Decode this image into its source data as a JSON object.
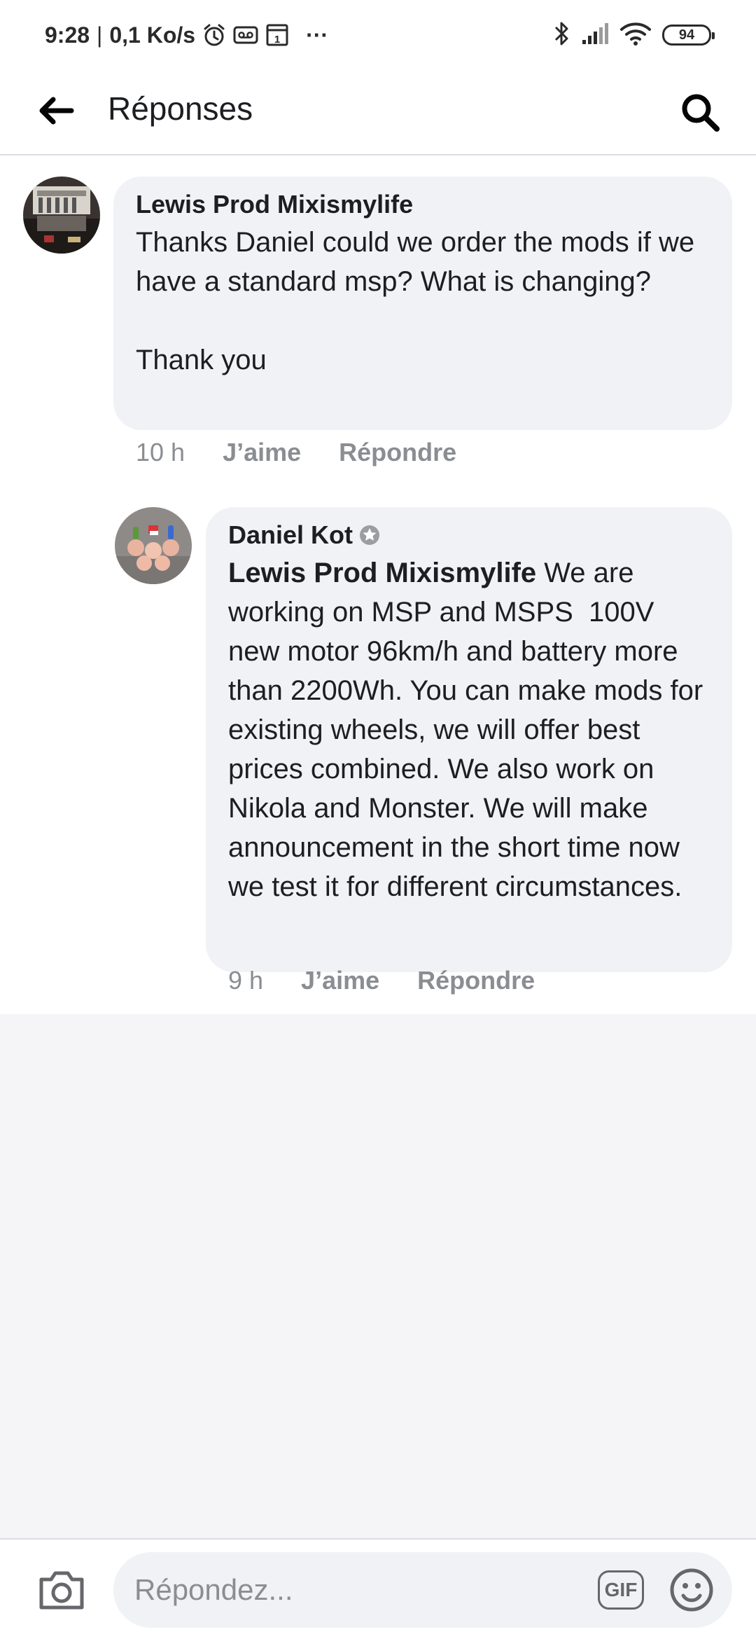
{
  "status_bar": {
    "time": "9:28",
    "separator": "|",
    "network_speed": "0,1 Ko/s",
    "more": "···",
    "battery": "94",
    "icons": [
      "alarm-icon",
      "voicemail-icon",
      "calendar-icon",
      "bluetooth-icon",
      "signal-icon",
      "wifi-icon",
      "battery-icon"
    ]
  },
  "header": {
    "title": "Réponses",
    "back_icon": "arrow-left-icon",
    "search_icon": "search-icon"
  },
  "comments": [
    {
      "author": "Lewis Prod Mixismylife",
      "text": "Thanks Daniel could we order the mods if we have a standard msp? What is changing?\n\nThank you",
      "time": "10 h",
      "like_label": "J’aime",
      "reply_label": "Répondre"
    },
    {
      "author": "Daniel Kot",
      "badge_icon": "top-fan-badge-icon",
      "mention": "Lewis Prod Mixismylife",
      "text": " We are working on MSP and MSPS  100V new motor 96km/h and battery more than 2200Wh. You can make mods for existing wheels, we will offer best prices combined. We also work on Nikola and Monster. We will make announcement in the short time now we test it for different circumstances.",
      "time": "9 h",
      "like_label": "J’aime",
      "reply_label": "Répondre"
    }
  ],
  "composer": {
    "placeholder": "Répondez...",
    "gif_label": "GIF",
    "camera_icon": "camera-icon",
    "emoji_icon": "emoji-icon"
  },
  "colors": {
    "bubble": "#f0f2f5",
    "meta_text": "#8a8d91",
    "background": "#f5f5f7"
  }
}
